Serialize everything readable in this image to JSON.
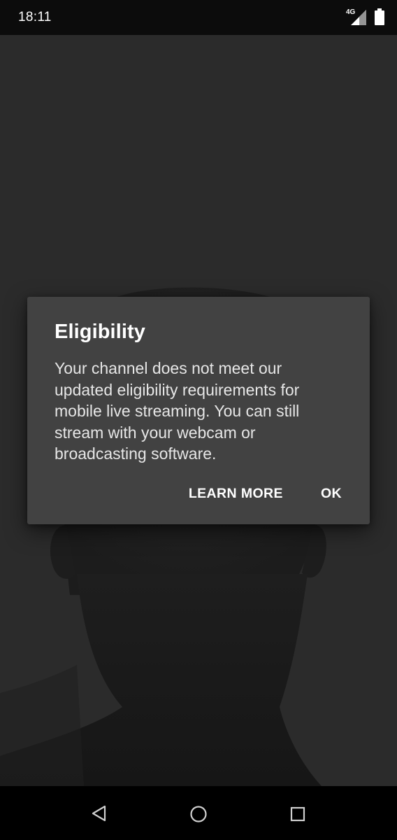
{
  "status_bar": {
    "time": "18:11",
    "network": "4G",
    "signal_icon": "signal-icon",
    "battery_icon": "battery-icon"
  },
  "dialog": {
    "title": "Eligibility",
    "message": "Your channel does not meet our updated eligibility requirements for mobile live streaming. You can still stream with your webcam or broadcasting software.",
    "learn_more_label": "LEARN MORE",
    "ok_label": "OK"
  },
  "nav_bar": {
    "back_icon": "back-triangle-icon",
    "home_icon": "home-circle-icon",
    "recents_icon": "recents-square-icon"
  },
  "colors": {
    "dialog_bg": "#424242",
    "background": "#2b2b2b",
    "text": "#ffffff"
  }
}
